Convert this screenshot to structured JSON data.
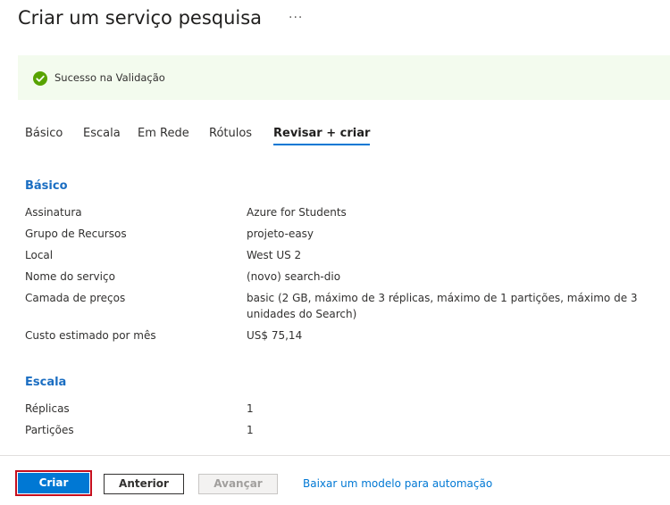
{
  "header": {
    "title": "Criar um serviço pesquisa",
    "more_label": "···"
  },
  "banner": {
    "status": "success",
    "icon": "checkmark-circle-icon",
    "text": "Sucesso na Validação",
    "color": "#57a300"
  },
  "tabs": [
    {
      "label": "Básico",
      "active": false
    },
    {
      "label": "Escala",
      "active": false
    },
    {
      "label": "Em Rede",
      "active": false
    },
    {
      "label": "Rótulos",
      "active": false
    },
    {
      "label": "Revisar + criar",
      "active": true
    }
  ],
  "sections": {
    "basico": {
      "title": "Básico",
      "rows": [
        {
          "label": "Assinatura",
          "value": "Azure for Students"
        },
        {
          "label": "Grupo de Recursos",
          "value": "projeto-easy"
        },
        {
          "label": "Local",
          "value": "West US 2"
        },
        {
          "label": "Nome do serviço",
          "value": "(novo) search-dio"
        },
        {
          "label": "Camada de preços",
          "value": "basic (2 GB, máximo de 3 réplicas, máximo de 1 partições, máximo de 3 unidades do Search)"
        },
        {
          "label": "Custo estimado por mês",
          "value": "US$ 75,14"
        }
      ]
    },
    "escala": {
      "title": "Escala",
      "rows": [
        {
          "label": "Réplicas",
          "value": "1"
        },
        {
          "label": "Partições",
          "value": "1"
        }
      ]
    }
  },
  "footer": {
    "create_label": "Criar",
    "previous_label": "Anterior",
    "next_label": "Avançar",
    "download_link": "Baixar um modelo para automação"
  },
  "colors": {
    "accent": "#0078d4",
    "highlight_border": "#c50f1f",
    "section_title": "#1b6ec2",
    "banner_background": "#f3fbee"
  }
}
